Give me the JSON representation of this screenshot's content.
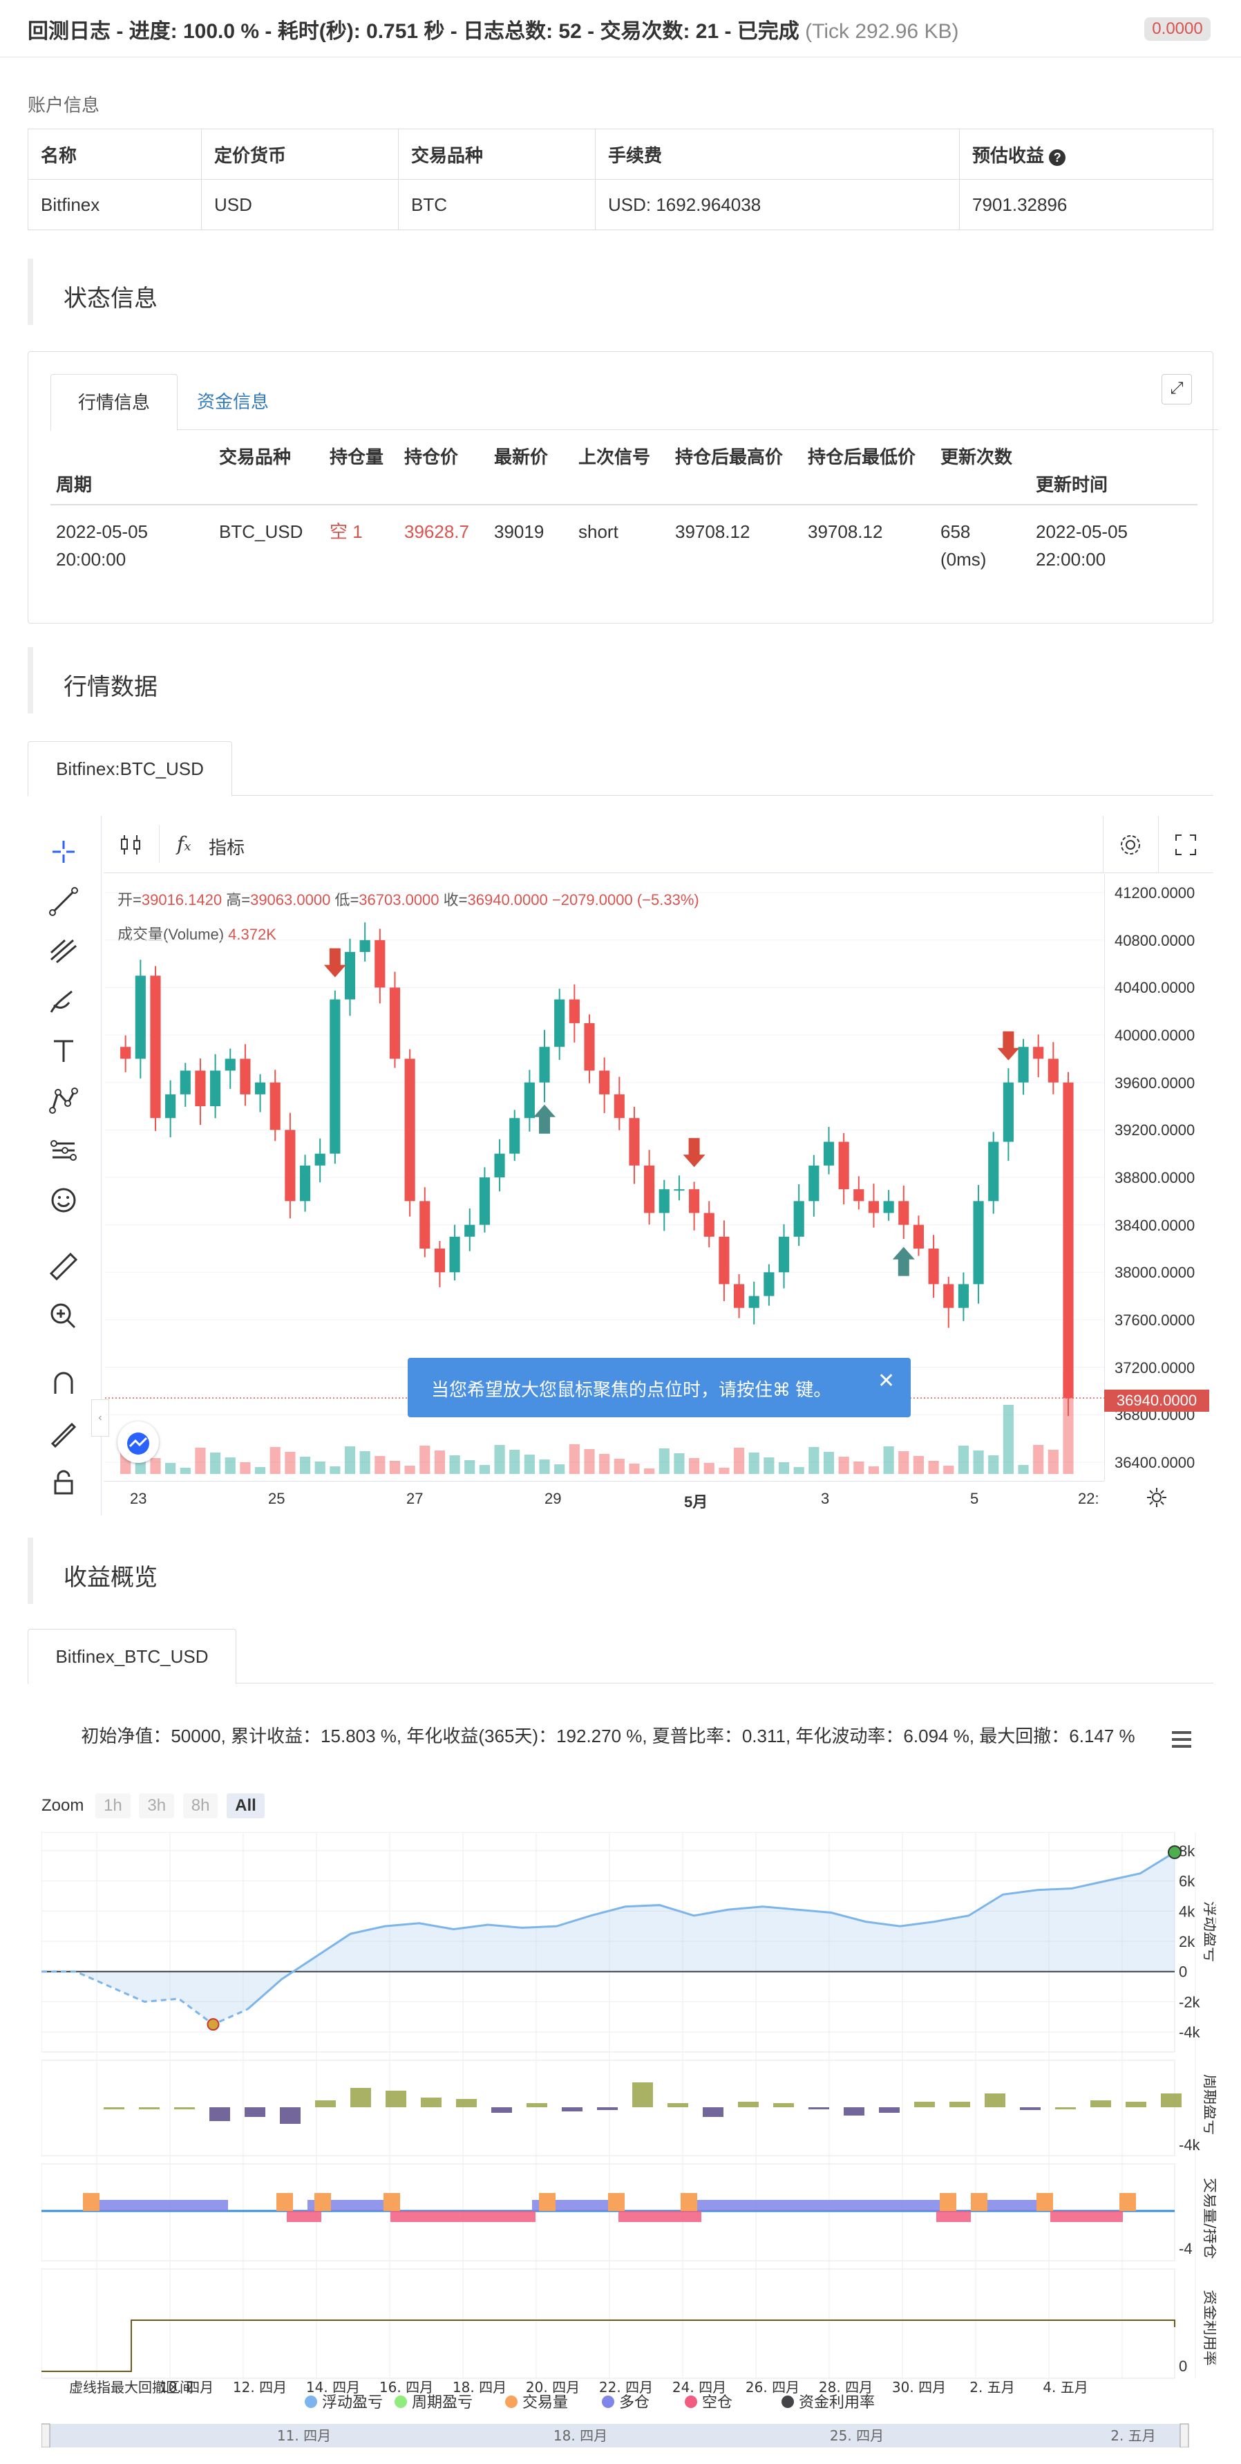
{
  "header": {
    "title": "回测日志 - 进度: 100.0 % - 耗时(秒): 0.751 秒 - 日志总数: 52 - 交易次数: 21 - 已完成",
    "tick": "(Tick 292.96 KB)",
    "badge": "0.0000"
  },
  "account": {
    "label": "账户信息",
    "columns": [
      "名称",
      "定价货币",
      "交易品种",
      "手续费",
      "预估收益"
    ],
    "row": [
      "Bitfinex",
      "USD",
      "BTC",
      "USD: 1692.964038",
      "7901.32896"
    ]
  },
  "status": {
    "title": "状态信息",
    "tabs": [
      "行情信息",
      "资金信息"
    ],
    "columns": [
      "周期",
      "交易品种",
      "持仓量",
      "持仓价",
      "最新价",
      "上次信号",
      "持仓后最高价",
      "持仓后最低价",
      "更新次数",
      "更新时间"
    ],
    "row": {
      "period_date": "2022-05-05",
      "period_time": "20:00:00",
      "symbol": "BTC_USD",
      "position": "空 1",
      "position_price": "39628.7",
      "last_price": "39019",
      "last_signal": "short",
      "high_after": "39708.12",
      "low_after": "39708.12",
      "update_count": "658",
      "update_ms": "(0ms)",
      "update_date": "2022-05-05",
      "update_time": "22:00:00"
    }
  },
  "market": {
    "title": "行情数据",
    "tab": "Bitfinex:BTC_USD",
    "indicator_label": "指标",
    "ohlc": {
      "open_label": "开=",
      "open": "39016.1420",
      "high_label": "高=",
      "high": "39063.0000",
      "low_label": "低=",
      "low": "36703.0000",
      "close_label": "收=",
      "close": "36940.0000",
      "change": "−2079.0000 (−5.33%)"
    },
    "volume_label": "成交量(Volume)",
    "volume_value": "4.372K",
    "tooltip": "当您希望放大您鼠标聚焦的点位时，请按住⌘ 键。",
    "price_badge": "36940.0000",
    "colors": {
      "up": "#26a69a",
      "down": "#ef5350",
      "arrow_down": "#d84a3a",
      "arrow_up": "#4a8c87",
      "tooltip": "#4a90e2"
    },
    "chart_data": {
      "type": "candlestick",
      "y_ticks": [
        "41200.0000",
        "40800.0000",
        "40400.0000",
        "40000.0000",
        "39600.0000",
        "39200.0000",
        "38800.0000",
        "38400.0000",
        "38000.0000",
        "37600.0000",
        "37200.0000",
        "36800.0000",
        "36400.0000"
      ],
      "ylim": [
        36300,
        41300
      ],
      "x_ticks": [
        "23",
        "25",
        "27",
        "29",
        "5月",
        "3",
        "5",
        "22:"
      ],
      "close_path": [
        39900,
        39800,
        40500,
        39300,
        39500,
        39700,
        39400,
        39700,
        39800,
        39500,
        39600,
        39200,
        38600,
        38900,
        39000,
        40300,
        40700,
        40800,
        40400,
        39800,
        38600,
        38200,
        38000,
        38300,
        38400,
        38800,
        39000,
        39300,
        39600,
        39900,
        40300,
        40100,
        39700,
        39500,
        39300,
        38900,
        38500,
        38700,
        38700,
        38500,
        38300,
        37900,
        37700,
        37800,
        38000,
        38300,
        38600,
        38900,
        39100,
        38700,
        38600,
        38500,
        38600,
        38400,
        38200,
        37900,
        37700,
        37900,
        38600,
        39100,
        39600,
        39900,
        39800,
        39600,
        36940
      ],
      "signals": [
        {
          "type": "short",
          "index": 15
        },
        {
          "type": "long",
          "index": 29
        },
        {
          "type": "short",
          "index": 39
        },
        {
          "type": "long",
          "index": 53
        },
        {
          "type": "short",
          "index": 60
        }
      ]
    }
  },
  "profit": {
    "title": "收益概览",
    "tab": "Bitfinex_BTC_USD",
    "summary": "初始净值：50000, 累计收益：15.803 %, 年化收益(365天)：192.270 %, 夏普比率：0.311, 年化波动率：6.094 %, 最大回撤：6.147 %",
    "zoom_label": "Zoom",
    "zoom_options": [
      "1h",
      "3h",
      "8h",
      "All"
    ],
    "panel1_ticks": [
      "8k",
      "6k",
      "4k",
      "2k",
      "0",
      "-2k",
      "-4k"
    ],
    "panel2_ticks": [
      "-4k"
    ],
    "panel3_ticks": [
      "-4"
    ],
    "panel4_ticks": [
      "0"
    ],
    "axis_titles": [
      "浮动盈亏",
      "周期盈亏",
      "交易量/持仓",
      "资金利用率"
    ],
    "x_ticks": [
      "10. 四月",
      "12. 四月",
      "14. 四月",
      "16. 四月",
      "18. 四月",
      "20. 四月",
      "22. 四月",
      "24. 四月",
      "26. 四月",
      "28. 四月",
      "30. 四月",
      "2. 五月",
      "4. 五月"
    ],
    "nav_ticks": [
      "11. 四月",
      "18. 四月",
      "25. 四月",
      "2. 五月"
    ],
    "legend": [
      "浮动盈亏",
      "周期盈亏",
      "交易量",
      "多仓",
      "空仓",
      "资金利用率"
    ],
    "legend_colors": [
      "#7cb5ec",
      "#90ed7d",
      "#f7a35c",
      "#8085e9",
      "#f15c80",
      "#434348"
    ],
    "overlap_text": "虚线指最大回撤区间",
    "chart_data": {
      "type": "line",
      "series": [
        {
          "name": "浮动盈亏",
          "values": [
            0,
            0,
            -1000,
            -2000,
            -1800,
            -3500,
            -2500,
            -500,
            1000,
            2500,
            3000,
            3200,
            2800,
            3100,
            2900,
            3000,
            3700,
            4300,
            4400,
            3700,
            4100,
            4300,
            4100,
            3900,
            3300,
            3000,
            3300,
            3700,
            5100,
            5400,
            5500,
            6000,
            6500,
            7900
          ]
        }
      ],
      "ylim": [
        -4500,
        8500
      ]
    }
  }
}
